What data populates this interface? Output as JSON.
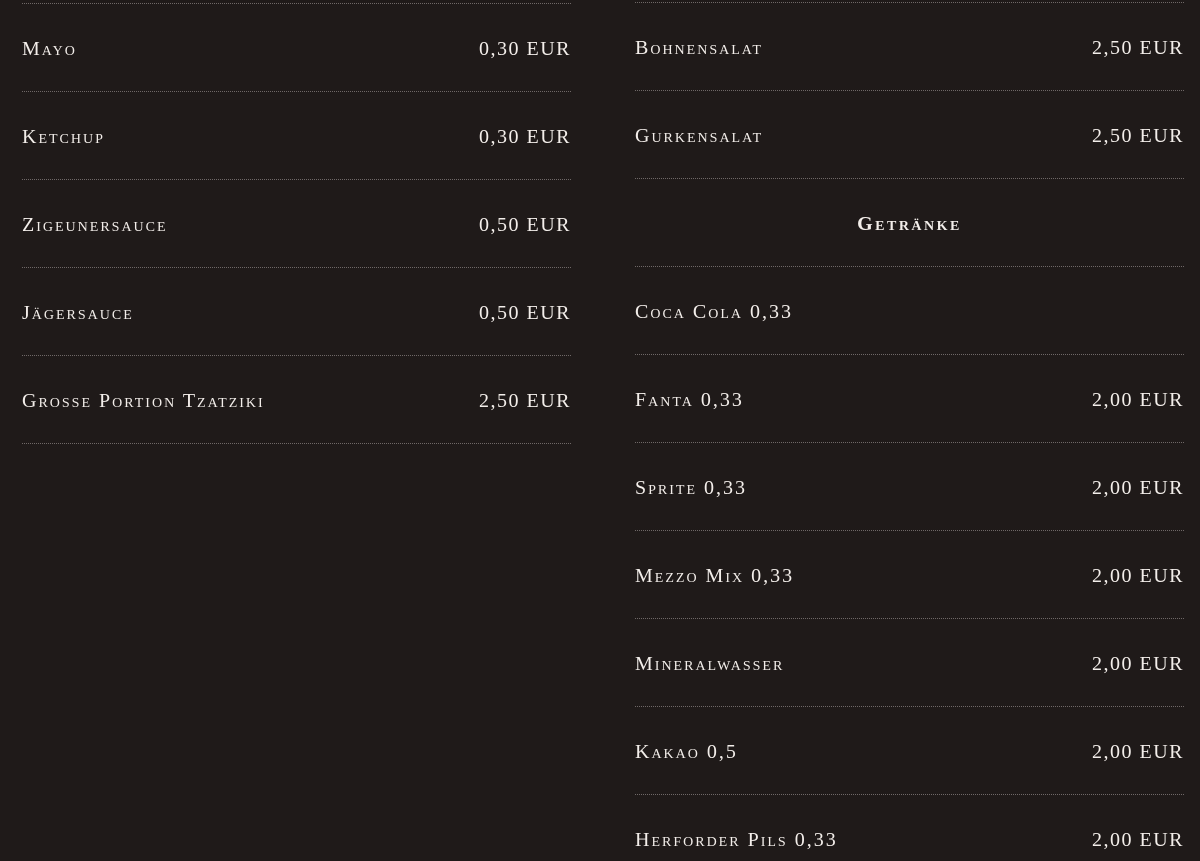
{
  "menu": {
    "left_items": [
      {
        "name": "Mayo",
        "price": "0,30 EUR"
      },
      {
        "name": "Ketchup",
        "price": "0,30 EUR"
      },
      {
        "name": "Zigeunersauce",
        "price": "0,50 EUR"
      },
      {
        "name": "Jägersauce",
        "price": "0,50 EUR"
      },
      {
        "name": "Grosse Portion Tzatziki",
        "price": "2,50 EUR"
      }
    ],
    "right_items_before_heading": [
      {
        "name": "Bohnensalat",
        "price": "2,50 EUR"
      },
      {
        "name": "Gurkensalat",
        "price": "2,50 EUR"
      }
    ],
    "drinks_heading": "Getränke",
    "drinks": [
      {
        "name": "Coca Cola 0,33",
        "price": ""
      },
      {
        "name": "Fanta 0,33",
        "price": "2,00 EUR"
      },
      {
        "name": "Sprite 0,33",
        "price": "2,00 EUR"
      },
      {
        "name": "Mezzo Mix 0,33",
        "price": "2,00 EUR"
      },
      {
        "name": "Mineralwasser",
        "price": "2,00 EUR"
      },
      {
        "name": "Kakao 0,5",
        "price": "2,00 EUR"
      },
      {
        "name": "Herforder Pils 0,33",
        "price": "2,00 EUR"
      }
    ]
  },
  "colors": {
    "background": "#1f1a19",
    "text": "#f3eeea",
    "divider": "#6f6867"
  }
}
